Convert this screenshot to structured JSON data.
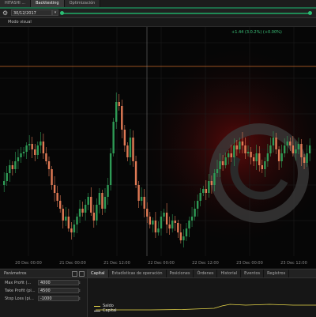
{
  "tabs": [
    {
      "label": "HITASHI ...",
      "active": false
    },
    {
      "label": "Backtesting",
      "active": true
    },
    {
      "label": "Optimización",
      "active": false
    }
  ],
  "toolbar": {
    "date": "30/12/2017"
  },
  "subbar": {
    "label": "Modo visual"
  },
  "chart": {
    "price_readout": "+1.44 (3.0.2%) (+0.00%)",
    "x_labels": [
      "20 Dec 00:00",
      "21 Dec 00:00",
      "21 Dec 12:00",
      "22 Dec 00:00",
      "22 Dec 12:00",
      "23 Dec 00:00",
      "23 Dec 12:00"
    ]
  },
  "bottom": {
    "left_title": "Parámetros",
    "fields": [
      {
        "label": "Max Profit (...",
        "value": "4000"
      },
      {
        "label": "Take Profit (pi...",
        "value": "4500"
      },
      {
        "label": "Stop Loss (pi...",
        "value": "-1000"
      }
    ],
    "right_tabs": [
      {
        "label": "Capital",
        "active": true
      },
      {
        "label": "Estadísticas de operación",
        "active": false
      },
      {
        "label": "Posiciones",
        "active": false
      },
      {
        "label": "Órdenes",
        "active": false
      },
      {
        "label": "Historial",
        "active": false
      },
      {
        "label": "Eventos",
        "active": false
      },
      {
        "label": "Registros",
        "active": false
      }
    ],
    "legend": [
      {
        "name": "Saldo",
        "color": "#e8d84a"
      },
      {
        "name": "Capital",
        "color": "#cfcfcf"
      }
    ]
  },
  "colors": {
    "bull": "#2e9a55",
    "bear": "#e07a55",
    "accent": "#1f8a55"
  }
}
